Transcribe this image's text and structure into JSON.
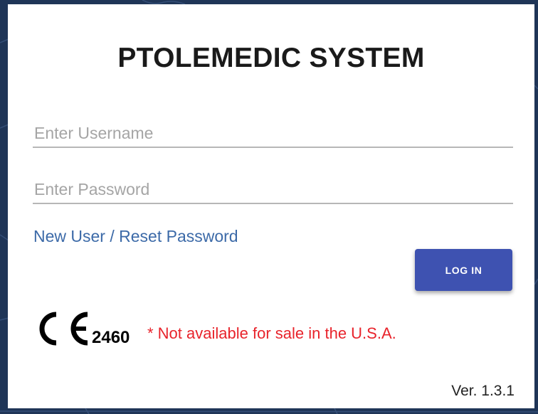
{
  "app": {
    "title": "PTOLEMEDIC SYSTEM"
  },
  "form": {
    "username_placeholder": "Enter Username",
    "username_value": "",
    "password_placeholder": "Enter Password",
    "password_value": "",
    "new_user_label": "New User",
    "separator": "/",
    "reset_password_label": "Reset Password",
    "login_label": "LOG IN"
  },
  "footer": {
    "ce_mark_icon": "ce-mark-icon",
    "ce_number": "2460",
    "disclaimer": "* Not available for sale in the U.S.A.",
    "version": "Ver. 1.3.1"
  },
  "colors": {
    "background": "#1f3557",
    "link": "#3c6aa8",
    "button": "#3e52b1",
    "disclaimer": "#e8232b"
  }
}
